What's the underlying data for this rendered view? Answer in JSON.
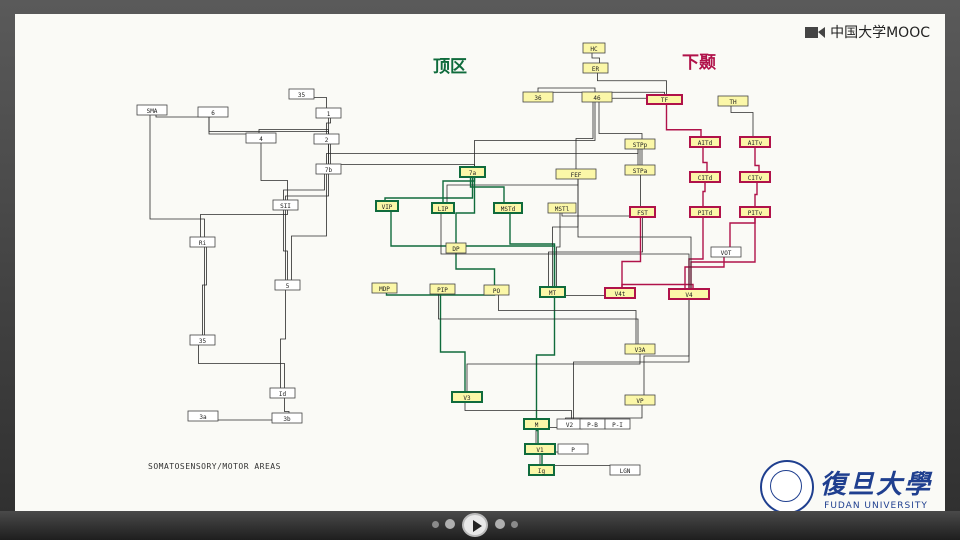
{
  "branding": {
    "platform": "中国大学MOOC",
    "university_cn": "復旦大學",
    "university_en": "FUDAN UNIVERSITY"
  },
  "labels": {
    "parietal": "顶区",
    "temporal": "下颞",
    "somato_caption": "SOMATOSENSORY/MOTOR AREAS"
  },
  "colors": {
    "dorsal": "#0f6b3c",
    "ventral": "#b0124a",
    "box_fill": "#fbf7a8",
    "line": "#2b2b2b"
  },
  "areas": {
    "HC": "HC",
    "ER": "ER",
    "s36": "36",
    "s46": "46",
    "TF": "TF",
    "TH": "TH",
    "STPp": "STPp",
    "STPa": "STPa",
    "FEF": "FEF",
    "s7a": "7a",
    "VIP": "VIP",
    "LIP": "LIP",
    "MSTd": "MSTd",
    "MSTl": "MSTl",
    "FST": "FST",
    "DP": "DP",
    "MDP": "MDP",
    "PIP": "PIP",
    "PO": "PO",
    "MT": "MT",
    "V4t": "V4t",
    "V4": "V4",
    "VOT": "VOT",
    "V3A": "V3A",
    "VP": "VP",
    "V3": "V3",
    "M": "M",
    "V2": "V2",
    "P-B": "P-B",
    "P-I": "P-I",
    "V1": "V1",
    "P": "P",
    "LGN": "LGN",
    "AITd": "AITd",
    "AITv": "AITv",
    "CITd": "CITd",
    "CITv": "CITv",
    "PITd": "PITd",
    "PITv": "PITv",
    "SMA": "SMA",
    "s6": "6",
    "s4": "4",
    "s35": "35",
    "s1": "1",
    "s2": "2",
    "s3a": "3a",
    "s3b": "3b",
    "s5": "5",
    "SII": "SII",
    "Ri": "Ri",
    "s7b": "7b",
    "s35b": "35",
    "Id": "Id",
    "Ig": "Ig"
  }
}
